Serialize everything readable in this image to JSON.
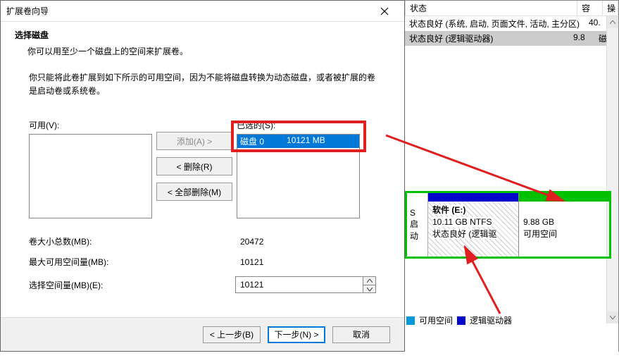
{
  "dialog": {
    "title": "扩展卷向导",
    "heading": "选择磁盘",
    "subheading": "你可以用至少一个磁盘上的空间来扩展卷。",
    "desc": "你只能将此卷扩展到如下所示的可用空间，因为不能将磁盘转换为动态磁盘，或者被扩展的卷是启动卷或系统卷。",
    "available_label": "可用(V):",
    "selected_label": "已选的(S):",
    "buttons": {
      "add": "添加(A) >",
      "remove": "< 删除(R)",
      "remove_all": "< 全部删除(M)",
      "back": "< 上一步(B)",
      "next": "下一步(N) >",
      "cancel": "取消"
    },
    "selected_item": {
      "disk": "磁盘 0",
      "size": "10121 MB"
    },
    "rows": {
      "total_label": "卷大小总数(MB):",
      "total_value": "20472",
      "max_label": "最大可用空间量(MB):",
      "max_value": "10121",
      "choose_label": "选择空间量(MB)(E):",
      "choose_value": "10121"
    }
  },
  "bg": {
    "headers": {
      "status": "状态",
      "capacity": "容",
      "ops": "操"
    },
    "row1": {
      "status": "状态良好 (系统, 启动, 页面文件, 活动, 主分区)",
      "cap": "40."
    },
    "row2": {
      "status": "状态良好 (逻辑驱动器)",
      "cap": "9.8",
      "rest": "磁"
    },
    "disk_info": {
      "label": "S",
      "sub": "启动"
    },
    "parts": {
      "e": {
        "title": "软件  (E:)",
        "line2": "10.11 GB NTFS",
        "line3": "状态良好 (逻辑驱"
      },
      "free": {
        "line2": "9.88 GB",
        "line3": "可用空间"
      }
    },
    "legend": {
      "free": "可用空间",
      "logical": "逻辑驱动器"
    }
  }
}
